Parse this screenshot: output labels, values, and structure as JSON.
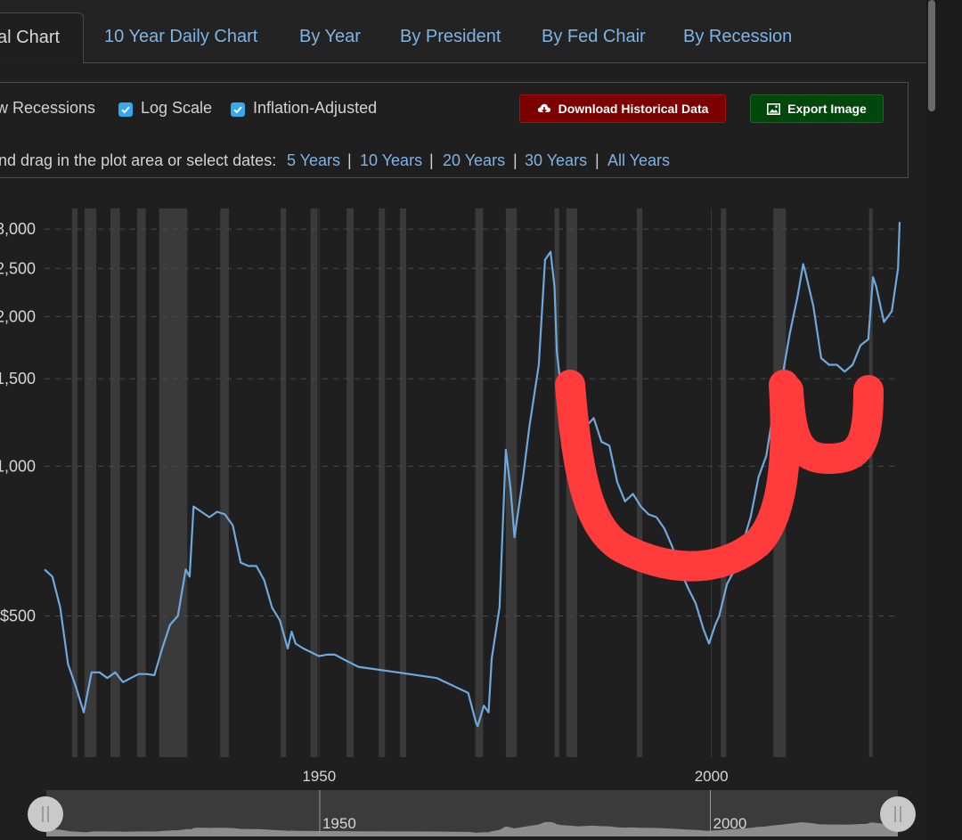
{
  "tabs": [
    {
      "label": "al Chart",
      "active": true
    },
    {
      "label": "10 Year Daily Chart"
    },
    {
      "label": "By Year"
    },
    {
      "label": "By President"
    },
    {
      "label": "By Fed Chair"
    },
    {
      "label": "By Recession"
    }
  ],
  "options": {
    "show_recessions": "w Recessions",
    "log_scale": "Log Scale",
    "inflation_adjusted": "Inflation-Adjusted"
  },
  "buttons": {
    "download": "Download Historical Data",
    "export": "Export Image"
  },
  "range_hint": "nd drag in the plot area or select dates:",
  "range_links": [
    "5 Years",
    "10 Years",
    "20 Years",
    "30 Years",
    "All Years"
  ],
  "colors": {
    "line": "#6fa8dc",
    "recession_band": "#3a3a3a",
    "annotation": "#ff3b3b",
    "download_bg": "#7d0000",
    "export_bg": "#00470c",
    "link": "#7fb3e3"
  },
  "icons": {
    "download": "cloud-download-icon",
    "export": "image-icon",
    "check": "checkmark-icon"
  },
  "chart_data": {
    "type": "line",
    "log_scale": true,
    "grid": "horizontal dashed",
    "x_range": [
      1915,
      2024
    ],
    "y_range": [
      260,
      3300
    ],
    "y_ticks": [
      {
        "value": 500,
        "label": "$500"
      },
      {
        "value": 1000,
        "label": "1,000"
      },
      {
        "value": 1500,
        "label": "1,500"
      },
      {
        "value": 2000,
        "label": "2,000"
      },
      {
        "value": 2500,
        "label": "2,500"
      },
      {
        "value": 3000,
        "label": "3,000"
      }
    ],
    "x_ticks": [
      {
        "value": 1950,
        "label": "1950"
      },
      {
        "value": 2000,
        "label": "2000"
      }
    ],
    "navigator_labels": [
      {
        "value": 1950,
        "label": "1950"
      },
      {
        "value": 2000,
        "label": "2000"
      }
    ],
    "recessions": [
      [
        1918.5,
        1919.2
      ],
      [
        1920.1,
        1921.6
      ],
      [
        1923.4,
        1924.6
      ],
      [
        1926.8,
        1927.9
      ],
      [
        1929.6,
        1933.2
      ],
      [
        1937.4,
        1938.5
      ],
      [
        1945.1,
        1945.8
      ],
      [
        1948.9,
        1949.8
      ],
      [
        1953.5,
        1954.4
      ],
      [
        1957.6,
        1958.4
      ],
      [
        1960.3,
        1961.1
      ],
      [
        1969.9,
        1970.9
      ],
      [
        1973.8,
        1975.2
      ],
      [
        1980.0,
        1980.6
      ],
      [
        1981.5,
        1982.9
      ],
      [
        1990.5,
        1991.2
      ],
      [
        2001.2,
        2001.9
      ],
      [
        2007.9,
        2009.5
      ],
      [
        2020.1,
        2020.3
      ]
    ],
    "series": [
      {
        "x": [
          1915,
          1916,
          1917,
          1918,
          1919,
          1920,
          1921,
          1922,
          1923,
          1924,
          1925,
          1926,
          1927,
          1928,
          1929,
          1930,
          1931,
          1932,
          1933,
          1933.5,
          1934,
          1935,
          1936,
          1937,
          1938,
          1939,
          1940,
          1941,
          1942,
          1943,
          1944,
          1945,
          1946,
          1946.5,
          1947,
          1948,
          1950,
          1951,
          1952,
          1953,
          1955,
          1960,
          1965,
          1969,
          1970,
          1970.2,
          1971,
          1971.6,
          1972,
          1973,
          1973.8,
          1974.4,
          1974.9,
          1976,
          1976.8,
          1978,
          1978.8,
          1979.5,
          1980.0,
          1980.3,
          1980.7,
          1981,
          1982,
          1983,
          1984,
          1985,
          1986,
          1987,
          1988,
          1989,
          1990,
          1991,
          1992,
          1993,
          1994,
          1995,
          1996,
          1997,
          1998,
          1999,
          1999.7,
          2000.5,
          2001,
          2002,
          2003,
          2004,
          2005,
          2006,
          2007,
          2008,
          2009,
          2010,
          2011,
          2011.7,
          2012,
          2013,
          2014,
          2015,
          2016,
          2017,
          2018,
          2019,
          2020,
          2020.6,
          2021,
          2022,
          2023,
          2023.8,
          2024
        ],
        "y": [
          620,
          600,
          520,
          400,
          360,
          320,
          385,
          385,
          375,
          385,
          368,
          375,
          382,
          382,
          380,
          430,
          480,
          500,
          620,
          600,
          830,
          810,
          790,
          810,
          800,
          760,
          640,
          630,
          630,
          590,
          520,
          490,
          430,
          465,
          440,
          430,
          415,
          418,
          418,
          410,
          395,
          385,
          375,
          350,
          305,
          300,
          330,
          320,
          410,
          520,
          1080,
          900,
          720,
          950,
          1200,
          1600,
          2600,
          2700,
          2300,
          1700,
          1500,
          1400,
          1250,
          1100,
          1200,
          1250,
          1120,
          1100,
          930,
          850,
          880,
          830,
          800,
          790,
          750,
          690,
          620,
          570,
          530,
          470,
          440,
          480,
          500,
          580,
          620,
          700,
          790,
          950,
          1050,
          1320,
          1500,
          1850,
          2200,
          2550,
          2450,
          2100,
          1650,
          1600,
          1600,
          1550,
          1600,
          1750,
          1800,
          2400,
          2300,
          1950,
          2050,
          2500,
          3100
        ]
      }
    ]
  }
}
